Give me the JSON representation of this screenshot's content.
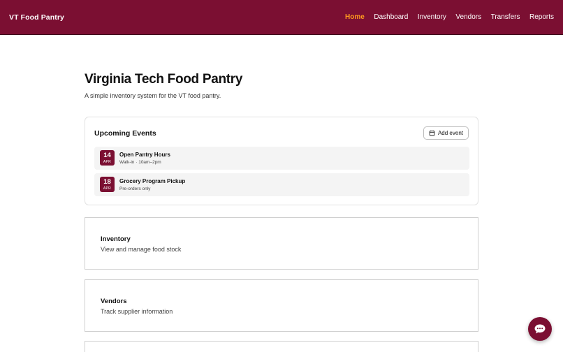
{
  "brand": {
    "name": "VT Food Pantry"
  },
  "nav": {
    "items": [
      {
        "label": "Home",
        "active": true
      },
      {
        "label": "Dashboard",
        "active": false
      },
      {
        "label": "Inventory",
        "active": false
      },
      {
        "label": "Vendors",
        "active": false
      },
      {
        "label": "Transfers",
        "active": false
      },
      {
        "label": "Reports",
        "active": false
      }
    ]
  },
  "page": {
    "title": "Virginia Tech Food Pantry",
    "subtitle": "A simple inventory system for the VT food pantry."
  },
  "events": {
    "title": "Upcoming Events",
    "add_label": "Add event",
    "items": [
      {
        "day": "14",
        "month": "APR",
        "name": "Open Pantry Hours",
        "detail": "Walk-in · 10am–2pm"
      },
      {
        "day": "18",
        "month": "APR",
        "name": "Grocery Program Pickup",
        "detail": "Pre-orders only"
      }
    ]
  },
  "cards": [
    {
      "title": "Inventory",
      "description": "View and manage food stock"
    },
    {
      "title": "Vendors",
      "description": "Track supplier information"
    }
  ],
  "colors": {
    "brand": "#7b0f32",
    "active_nav": "#ff9a1f"
  },
  "icons": {
    "calendar": "calendar-icon",
    "chat": "chat-bubble-icon"
  }
}
